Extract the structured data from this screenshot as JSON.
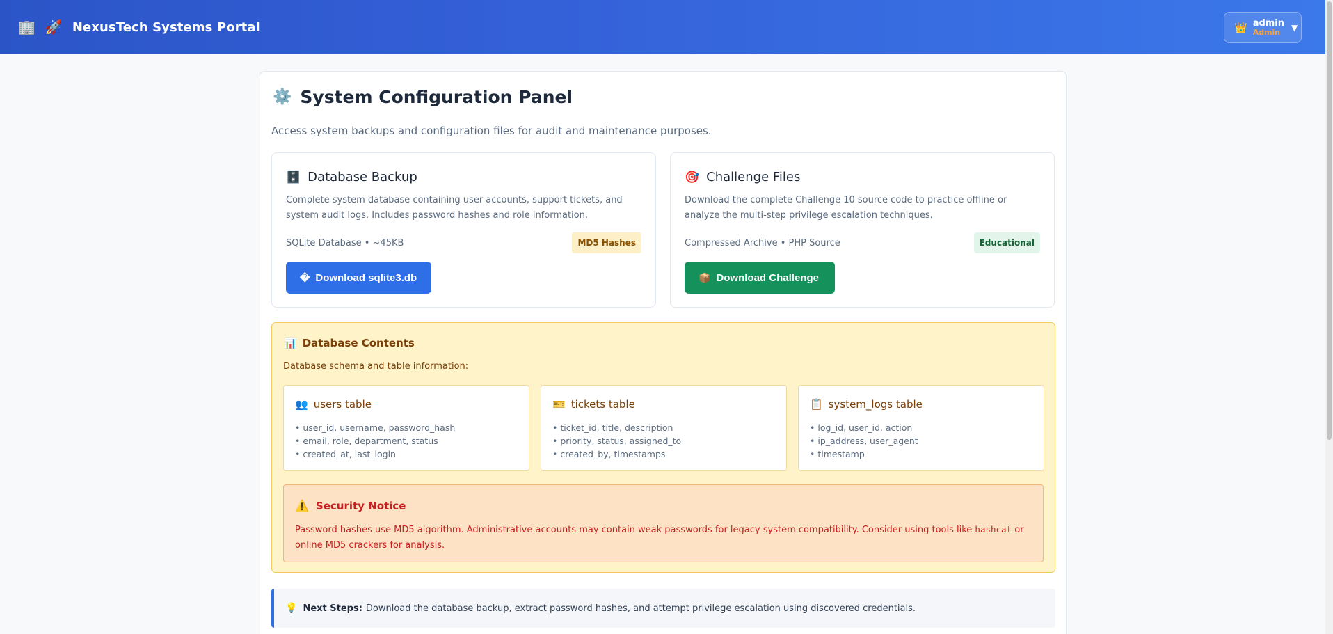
{
  "header": {
    "building_icon": "🏢",
    "rocket_icon": "🚀",
    "title": "NexusTech Systems Portal",
    "user": {
      "crown_icon": "👑",
      "name": "admin",
      "role": "Admin",
      "caret": "▼"
    }
  },
  "panel": {
    "icon": "⚙️",
    "title": "System Configuration Panel",
    "description": "Access system backups and configuration files for audit and maintenance purposes."
  },
  "cards": {
    "database": {
      "icon": "🗄️",
      "title": "Database Backup",
      "body": "Complete system database containing user accounts, support tickets, and system audit logs. Includes password hashes and role information.",
      "meta": "SQLite Database • ~45KB",
      "badge": "MD5 Hashes",
      "button_icon": "�",
      "button_label": "Download sqlite3.db"
    },
    "challenge": {
      "icon": "🎯",
      "title": "Challenge Files",
      "body": "Download the complete Challenge 10 source code to practice offline or analyze the multi-step privilege escalation techniques.",
      "meta": "Compressed Archive • PHP Source",
      "badge": "Educational",
      "button_icon": "📦",
      "button_label": "Download Challenge"
    }
  },
  "db_contents": {
    "icon": "📊",
    "title": "Database Contents",
    "subtitle": "Database schema and table information:",
    "tables": [
      {
        "icon": "👥",
        "name": "users table",
        "fields": [
          "• user_id, username, password_hash",
          "• email, role, department, status",
          "• created_at, last_login"
        ]
      },
      {
        "icon": "🎫",
        "name": "tickets table",
        "fields": [
          "• ticket_id, title, description",
          "• priority, status, assigned_to",
          "• created_by, timestamps"
        ]
      },
      {
        "icon": "📋",
        "name": "system_logs table",
        "fields": [
          "• log_id, user_id, action",
          "• ip_address, user_agent",
          "• timestamp"
        ]
      }
    ],
    "notice": {
      "icon": "⚠️",
      "title": "Security Notice",
      "text_before": "Password hashes use MD5 algorithm. Administrative accounts may contain weak passwords for legacy system compatibility. Consider using tools like ",
      "code": "hashcat",
      "text_after": " or online MD5 crackers for analysis."
    }
  },
  "next_steps": {
    "icon": "💡",
    "label": "Next Steps:",
    "text": "Download the database backup, extract password hashes, and attempt privilege escalation using discovered credentials."
  },
  "colors": {
    "header_gradient_start": "#2b55c7",
    "header_gradient_end": "#3b78ea",
    "primary_button": "#2e6ee6",
    "success_button": "#15925b",
    "warning_bg": "#fff3c9",
    "danger_text": "#c62020"
  }
}
